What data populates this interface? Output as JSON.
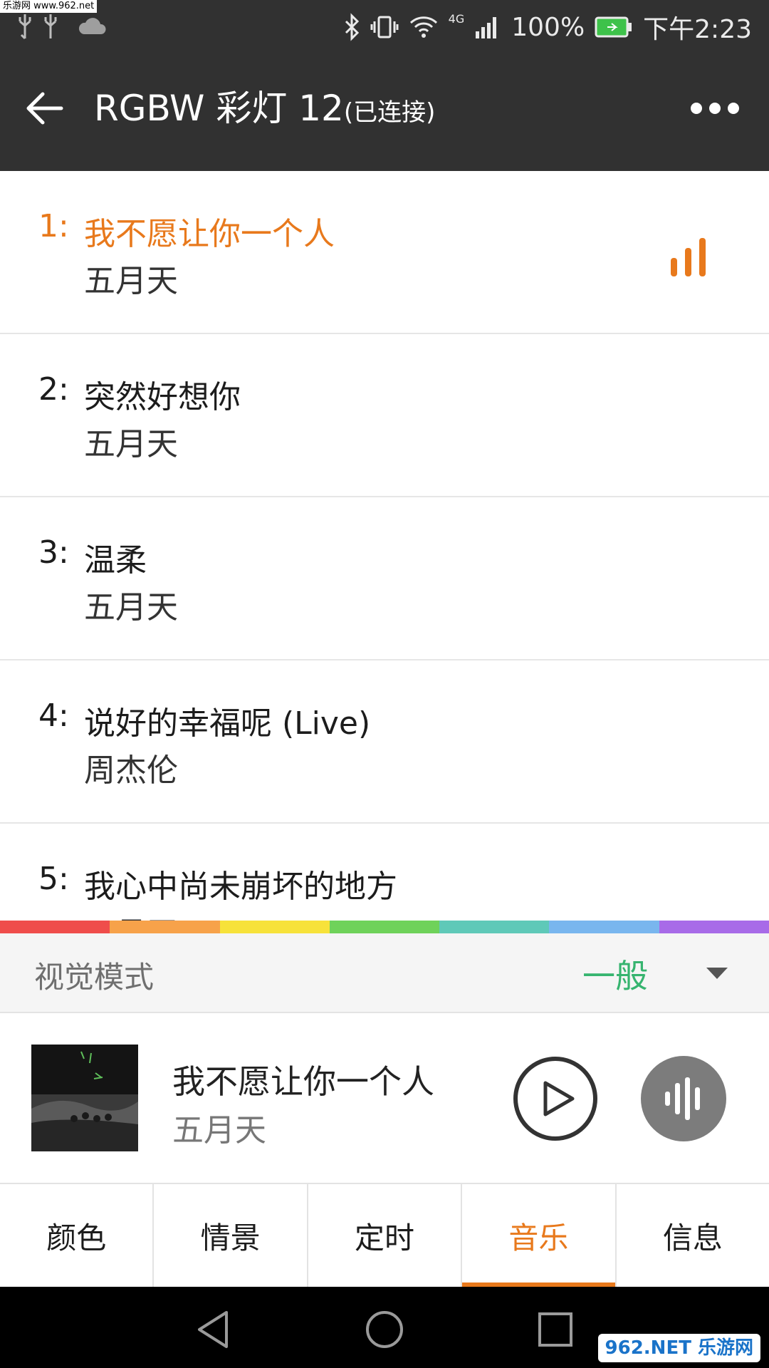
{
  "status_bar": {
    "watermark": "乐游网 www.962.net",
    "battery": "100%",
    "network": "4G",
    "time": "下午2:23",
    "icons": [
      "usb-icon",
      "usb-icon",
      "cloud-icon",
      "bluetooth-icon",
      "vibrate-icon",
      "wifi-icon",
      "signal-icon",
      "battery-icon"
    ]
  },
  "app_bar": {
    "title": "RGBW 彩灯 12",
    "status": "(已连接)"
  },
  "songs": [
    {
      "index": "1:",
      "title": "我不愿让你一个人",
      "artist": "五月天"
    },
    {
      "index": "2:",
      "title": "突然好想你",
      "artist": "五月天"
    },
    {
      "index": "3:",
      "title": "温柔",
      "artist": "五月天"
    },
    {
      "index": "4:",
      "title": "说好的幸福呢 (Live)",
      "artist": "周杰伦"
    },
    {
      "index": "5:",
      "title": "我心中尚未崩坏的地方",
      "artist": "五月天"
    }
  ],
  "rainbow_colors": [
    "#ef4d4b",
    "#f7a24a",
    "#f7e23a",
    "#6fd25a",
    "#5fc9b8",
    "#79b6ee",
    "#a86be8"
  ],
  "visual_mode": {
    "label": "视觉模式",
    "value": "一般"
  },
  "player": {
    "title": "我不愿让你一个人",
    "artist": "五月天"
  },
  "tabs": [
    {
      "label": "颜色"
    },
    {
      "label": "情景"
    },
    {
      "label": "定时"
    },
    {
      "label": "音乐"
    },
    {
      "label": "信息"
    }
  ],
  "watermark_bottom": "962.NET 乐游网",
  "colors": {
    "accent": "#e8791c",
    "mode_green": "#36b46f",
    "header": "#313131"
  }
}
